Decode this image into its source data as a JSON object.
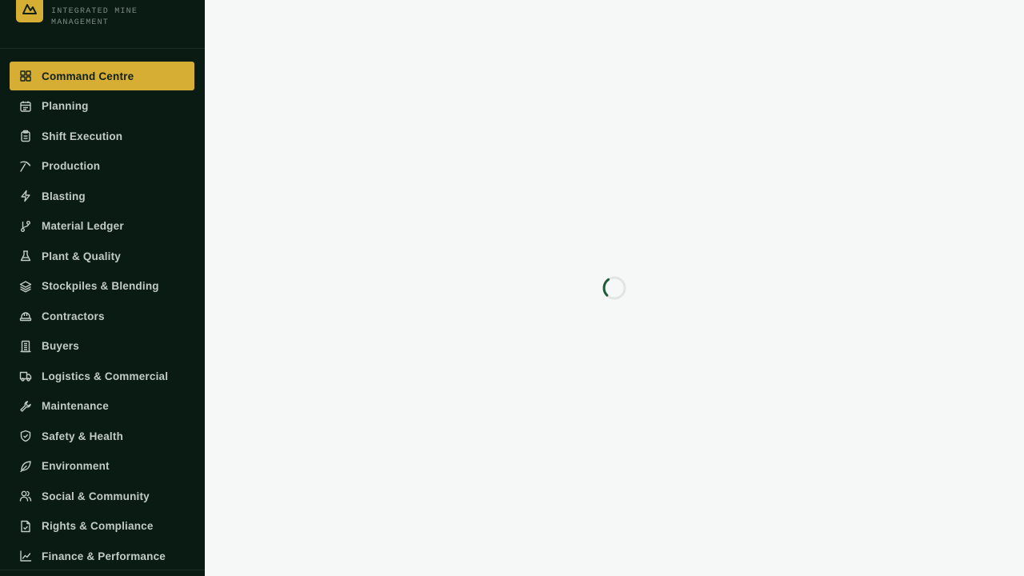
{
  "brand": {
    "tagline": "INTEGRATED MINE MANAGEMENT",
    "logo_icon": "mountain-icon",
    "accent_color": "#d6ae33"
  },
  "sidebar": {
    "background": "#0a1b14",
    "items": [
      {
        "label": "Command Centre",
        "icon": "dashboard-icon",
        "active": true
      },
      {
        "label": "Planning",
        "icon": "calendar-icon",
        "active": false
      },
      {
        "label": "Shift Execution",
        "icon": "clipboard-icon",
        "active": false
      },
      {
        "label": "Production",
        "icon": "pickaxe-icon",
        "active": false
      },
      {
        "label": "Blasting",
        "icon": "lightning-icon",
        "active": false
      },
      {
        "label": "Material Ledger",
        "icon": "git-branch-icon",
        "active": false
      },
      {
        "label": "Plant & Quality",
        "icon": "flask-icon",
        "active": false
      },
      {
        "label": "Stockpiles & Blending",
        "icon": "layers-icon",
        "active": false
      },
      {
        "label": "Contractors",
        "icon": "hard-hat-icon",
        "active": false
      },
      {
        "label": "Buyers",
        "icon": "building-icon",
        "active": false
      },
      {
        "label": "Logistics & Commercial",
        "icon": "truck-icon",
        "active": false
      },
      {
        "label": "Maintenance",
        "icon": "wrench-icon",
        "active": false
      },
      {
        "label": "Safety & Health",
        "icon": "shield-check-icon",
        "active": false
      },
      {
        "label": "Environment",
        "icon": "leaf-icon",
        "active": false
      },
      {
        "label": "Social & Community",
        "icon": "users-icon",
        "active": false
      },
      {
        "label": "Rights & Compliance",
        "icon": "file-check-icon",
        "active": false
      },
      {
        "label": "Finance & Performance",
        "icon": "line-chart-icon",
        "active": false
      }
    ]
  },
  "main": {
    "state": "loading",
    "spinner_icon": "loading-spinner-icon",
    "spinner_color": "#1f5a3a"
  }
}
